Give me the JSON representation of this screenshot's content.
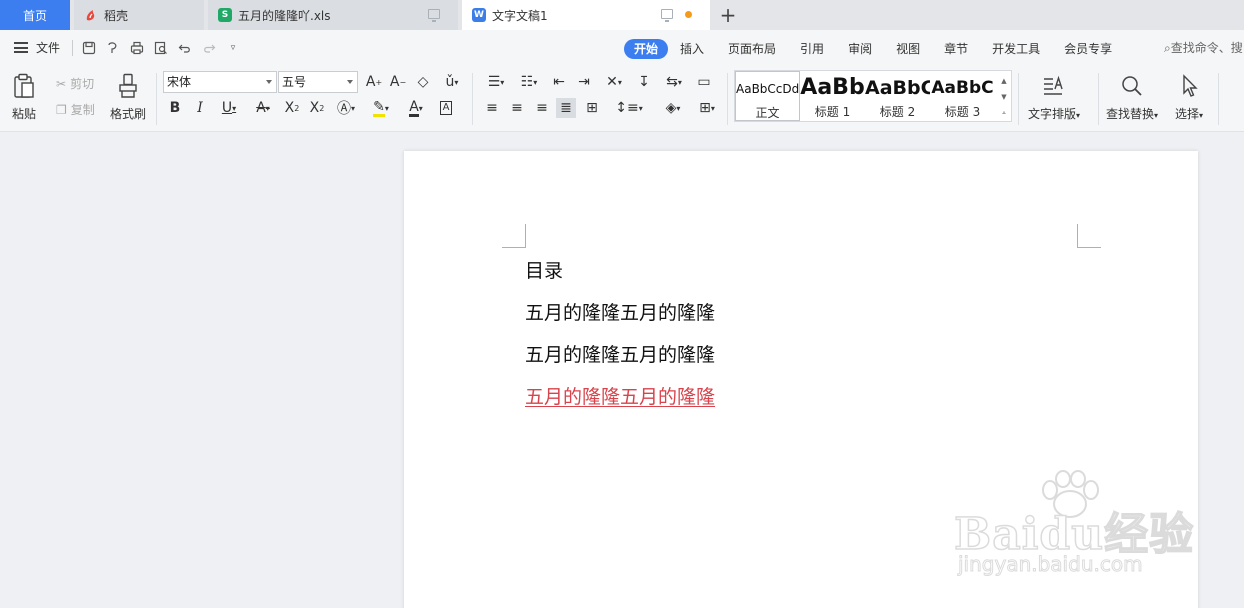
{
  "tabs": {
    "home": "首页",
    "t1": "稻壳",
    "t2": "五月的隆隆吖.xls",
    "t3": "文字文稿1",
    "add_label": "+"
  },
  "menu": {
    "file": "文件",
    "tabs": [
      "开始",
      "插入",
      "页面布局",
      "引用",
      "审阅",
      "视图",
      "章节",
      "开发工具",
      "会员专享"
    ],
    "search_cmd": "查找命令、搜"
  },
  "ribbon": {
    "paste": "粘贴",
    "cut": "剪切",
    "copy": "复制",
    "format_painter": "格式刷",
    "font_name": "宋体",
    "font_size": "五号",
    "styles": [
      {
        "sample": "AaBbCcDd",
        "name": "正文"
      },
      {
        "sample": "AaBb",
        "name": "标题 1"
      },
      {
        "sample": "AaBbC",
        "name": "标题 2"
      },
      {
        "sample": "AaBbC",
        "name": "标题 3"
      }
    ],
    "text_layout": "文字排版",
    "find_replace": "查找替换",
    "select": "选择"
  },
  "document": {
    "lines": [
      "目录",
      "五月的隆隆五月的隆隆",
      "五月的隆隆五月的隆隆",
      "五月的隆隆五月的隆隆"
    ]
  },
  "watermark": {
    "main": "Baidu经验",
    "sub": "jingyan.baidu.com"
  },
  "colors": {
    "accent": "#3c7df0",
    "hyperlink_red": "#d8434c",
    "unsaved_dot": "#f29b1d",
    "sheet_icon": "#1fa866",
    "doc_icon": "#3b7ee8"
  }
}
